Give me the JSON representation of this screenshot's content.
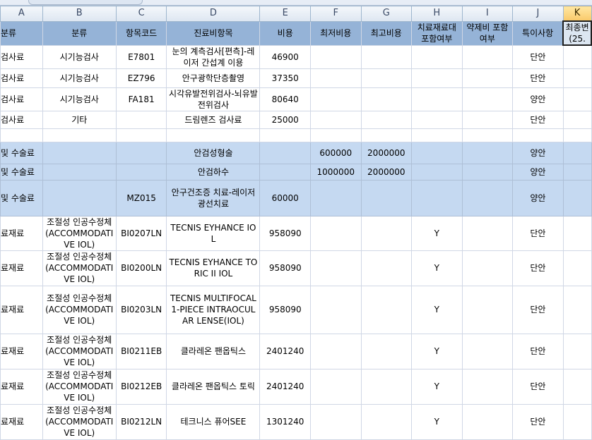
{
  "columns": [
    "A",
    "B",
    "C",
    "D",
    "E",
    "F",
    "G",
    "H",
    "I",
    "J",
    "K"
  ],
  "fields": [
    "분류",
    "분류",
    "항목코드",
    "진료비항목",
    "비용",
    "최저비용",
    "최고비용",
    "치료재료대 포함여부",
    "약제비 포함 여부",
    "특이사항",
    "최종변 (25."
  ],
  "rows": [
    {
      "band": false,
      "cells": [
        "검사료",
        "시기능검사",
        "E7801",
        "눈의 계측검사[편측]-레이저 간섭계 이용",
        "46900",
        "",
        "",
        "",
        "",
        "단안",
        ""
      ]
    },
    {
      "band": false,
      "cells": [
        "검사료",
        "시기능검사",
        "EZ796",
        "안구광학단층촬영",
        "37350",
        "",
        "",
        "",
        "",
        "단안",
        ""
      ]
    },
    {
      "band": false,
      "cells": [
        "검사료",
        "시기능검사",
        "FA181",
        "시각유발전위검사-뇌유발전위검사",
        "80640",
        "",
        "",
        "",
        "",
        "양안",
        ""
      ]
    },
    {
      "band": false,
      "cells": [
        "검사료",
        "기타",
        "",
        "드림렌즈 검사료",
        "25000",
        "",
        "",
        "",
        "",
        "단안",
        ""
      ]
    },
    {
      "band": false,
      "cells": [
        "",
        "",
        "",
        "",
        "",
        "",
        "",
        "",
        "",
        "",
        ""
      ]
    },
    {
      "band": true,
      "cells": [
        "및 수술료",
        "",
        "",
        "안검성형술",
        "",
        "600000",
        "2000000",
        "",
        "",
        "양안",
        ""
      ]
    },
    {
      "band": true,
      "cells": [
        "및 수술료",
        "",
        "",
        "안검하수",
        "",
        "1000000",
        "2000000",
        "",
        "",
        "양안",
        ""
      ]
    },
    {
      "band": true,
      "cells": [
        "및 수술료",
        "",
        "MZ015",
        "안구건조증 치료-레이저광선치료",
        "60000",
        "",
        "",
        "",
        "",
        "양안",
        ""
      ]
    },
    {
      "band": false,
      "cells": [
        "료재료",
        "조절성 인공수정체(ACCOMMODATIVE IOL)",
        "BI0207LN",
        "TECNIS EYHANCE IOL",
        "958090",
        "",
        "",
        "Y",
        "",
        "단안",
        ""
      ]
    },
    {
      "band": false,
      "cells": [
        "료재료",
        "조절성 인공수정체(ACCOMMODATIVE IOL)",
        "BI0200LN",
        "TECNIS EYHANCE TORIC II IOL",
        "958090",
        "",
        "",
        "Y",
        "",
        "단안",
        ""
      ]
    },
    {
      "band": false,
      "cells": [
        "료재료",
        "조절성 인공수정체(ACCOMMODATIVE IOL)",
        "BI0203LN",
        "TECNIS MULTIFOCAL 1-PIECE INTRAOCULAR LENSE(IOL)",
        "958090",
        "",
        "",
        "Y",
        "",
        "단안",
        ""
      ]
    },
    {
      "band": false,
      "cells": [
        "료재료",
        "조절성 인공수정체(ACCOMMODATIVE IOL)",
        "BI0211EB",
        "클라레온 팬옵틱스",
        "2401240",
        "",
        "",
        "Y",
        "",
        "단안",
        ""
      ]
    },
    {
      "band": false,
      "cells": [
        "료재료",
        "조절성 인공수정체(ACCOMMODATIVE IOL)",
        "BI0212EB",
        "클라레온 팬옵틱스 토릭",
        "2401240",
        "",
        "",
        "Y",
        "",
        "단안",
        ""
      ]
    },
    {
      "band": false,
      "cells": [
        "료재료",
        "조절성 인공수정체(ACCOMMODATIVE IOL)",
        "BI0212LN",
        "테크니스 퓨어SEE",
        "1301240",
        "",
        "",
        "Y",
        "",
        "단안",
        ""
      ]
    }
  ]
}
